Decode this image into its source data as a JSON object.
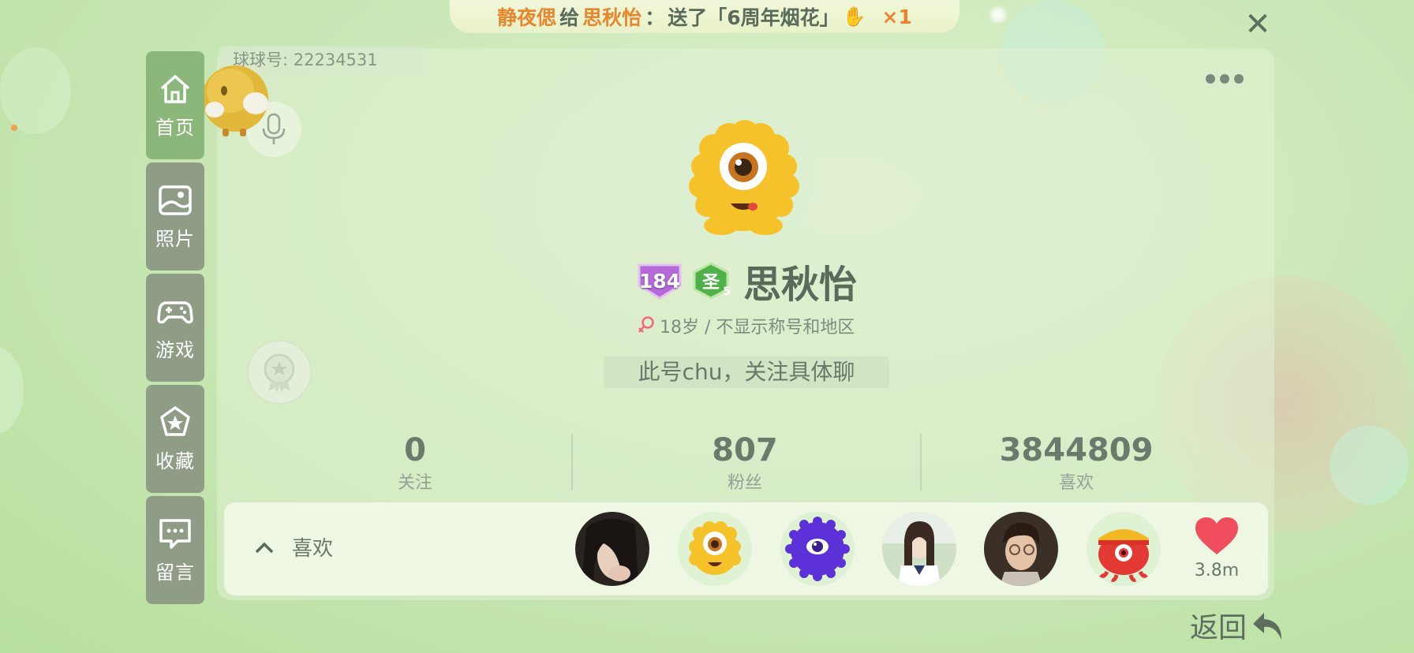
{
  "banner": {
    "sender": "静夜偲",
    "verb": "给",
    "receiver": "思秋怡",
    "colon": "：",
    "action": "送了「6周年烟花」",
    "quantity": "×1"
  },
  "close_label": "✕",
  "nav": {
    "items": [
      {
        "label": "首页",
        "icon": "home-icon"
      },
      {
        "label": "照片",
        "icon": "photo-icon"
      },
      {
        "label": "游戏",
        "icon": "gamepad-icon"
      },
      {
        "label": "收藏",
        "icon": "star-icon"
      },
      {
        "label": "留言",
        "icon": "message-icon"
      }
    ]
  },
  "profile": {
    "id_text": "球球号: 22234531",
    "level": "184",
    "rank": "圣",
    "rank_tier": "5",
    "nickname": "思秋怡",
    "meta": "18岁 / 不显示称号和地区",
    "bio": "此号chu，关注具体聊"
  },
  "stats": [
    {
      "value": "0",
      "label": "关注"
    },
    {
      "value": "807",
      "label": "粉丝"
    },
    {
      "value": "3844809",
      "label": "喜欢"
    }
  ],
  "likes_bar": {
    "label": "喜欢",
    "heart_count": "3.8m"
  },
  "back_label": "返回",
  "colors": {
    "accent_green": "#8bb77b",
    "nav_gray": "#8f9d87",
    "banner_orange": "#e8862e",
    "heart_red": "#f04e5e"
  }
}
